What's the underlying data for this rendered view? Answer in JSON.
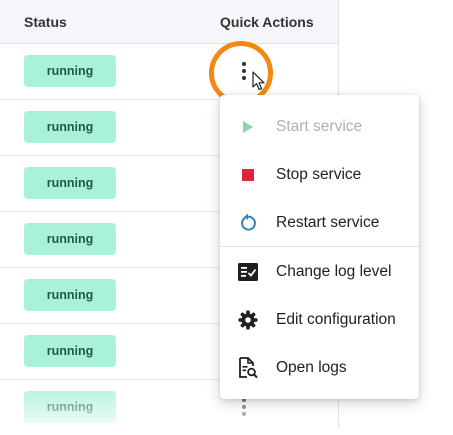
{
  "table": {
    "headers": {
      "status": "Status",
      "quick_actions": "Quick Actions"
    },
    "rows": [
      {
        "status": "running"
      },
      {
        "status": "running"
      },
      {
        "status": "running"
      },
      {
        "status": "running"
      },
      {
        "status": "running"
      },
      {
        "status": "running"
      },
      {
        "status": "running"
      }
    ],
    "status_badge_color": "#a9f1d7"
  },
  "highlight_color": "#f08a12",
  "menu": {
    "items": [
      {
        "label": "Start service",
        "icon": "play-icon",
        "disabled": true
      },
      {
        "label": "Stop service",
        "icon": "stop-icon"
      },
      {
        "label": "Restart service",
        "icon": "restart-icon"
      },
      {
        "label": "Change log level",
        "icon": "log-level-icon"
      },
      {
        "label": "Edit configuration",
        "icon": "gear-icon"
      },
      {
        "label": "Open logs",
        "icon": "open-logs-icon"
      }
    ]
  }
}
